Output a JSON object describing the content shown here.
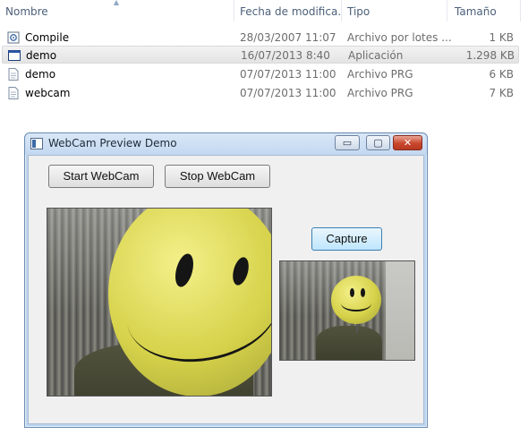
{
  "explorer": {
    "columns": {
      "name": "Nombre",
      "date": "Fecha de modifica...",
      "type": "Tipo",
      "size": "Tamaño"
    },
    "files": [
      {
        "name": "Compile",
        "date": "28/03/2007 11:07",
        "type": "Archivo por lotes ...",
        "size": "1 KB",
        "icon": "batch-file-icon"
      },
      {
        "name": "demo",
        "date": "16/07/2013 8:40",
        "type": "Aplicación",
        "size": "1.298 KB",
        "icon": "application-icon",
        "selected": true
      },
      {
        "name": "demo",
        "date": "07/07/2013 11:00",
        "type": "Archivo PRG",
        "size": "6 KB",
        "icon": "prg-file-icon"
      },
      {
        "name": "webcam",
        "date": "07/07/2013 11:00",
        "type": "Archivo PRG",
        "size": "7 KB",
        "icon": "prg-file-icon"
      }
    ]
  },
  "window": {
    "title": "WebCam Preview Demo",
    "controls": {
      "minimize": "▭",
      "maximize": "▢",
      "close": "✕"
    }
  },
  "buttons": {
    "start": "Start WebCam",
    "stop": "Stop WebCam",
    "capture": "Capture"
  },
  "colors": {
    "balloon": "#e0dc5a",
    "accent": "#3c7fb1"
  }
}
